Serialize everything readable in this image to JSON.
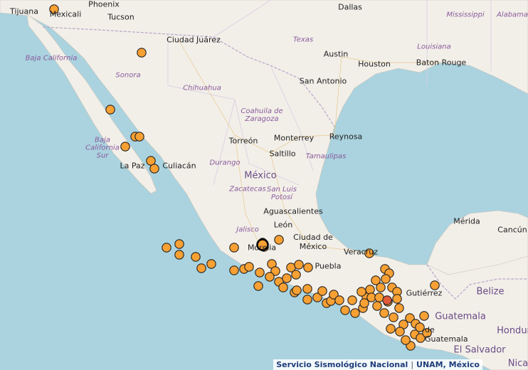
{
  "map": {
    "colors": {
      "land": "#f2efe9",
      "water": "#aad3df",
      "marker_fill": "#f7a033",
      "marker_stroke": "#222222",
      "highlight": "#e05a3a",
      "border": "#b9a6c9"
    },
    "labels": [
      {
        "id": "tijuana",
        "text": "Tijuana",
        "type": "city"
      },
      {
        "id": "mexicali",
        "text": "Mexicali",
        "type": "city"
      },
      {
        "id": "phoenix",
        "text": "Phoenix",
        "type": "city"
      },
      {
        "id": "tucson",
        "text": "Tucson",
        "type": "city"
      },
      {
        "id": "dallas",
        "text": "Dallas",
        "type": "city"
      },
      {
        "id": "ciudad-juarez",
        "text": "Ciudad Juárez",
        "type": "city"
      },
      {
        "id": "texas",
        "text": "Texas",
        "type": "state"
      },
      {
        "id": "austin",
        "text": "Austin",
        "type": "city"
      },
      {
        "id": "houston",
        "text": "Houston",
        "type": "city"
      },
      {
        "id": "san-antonio",
        "text": "San Antonio",
        "type": "city"
      },
      {
        "id": "baton-rouge",
        "text": "Baton Rouge",
        "type": "city"
      },
      {
        "id": "louisiana",
        "text": "Louisiana",
        "type": "state"
      },
      {
        "id": "mississippi",
        "text": "Mississippi",
        "type": "state"
      },
      {
        "id": "alabama",
        "text": "Alabama",
        "type": "state"
      },
      {
        "id": "baja-california",
        "text": "Baja California",
        "type": "state"
      },
      {
        "id": "sonora",
        "text": "Sonora",
        "type": "state"
      },
      {
        "id": "chihuahua",
        "text": "Chihuahua",
        "type": "state"
      },
      {
        "id": "coahuila",
        "text": "Coahuila de Zaragoza",
        "type": "state"
      },
      {
        "id": "monterrey",
        "text": "Monterrey",
        "type": "city"
      },
      {
        "id": "reynosa",
        "text": "Reynosa",
        "type": "city"
      },
      {
        "id": "torreon",
        "text": "Torreón",
        "type": "city"
      },
      {
        "id": "saltillo",
        "text": "Saltillo",
        "type": "city"
      },
      {
        "id": "tamaulipas",
        "text": "Tamaulipas",
        "type": "state"
      },
      {
        "id": "baja-california-sur",
        "text": "Baja California Sur",
        "type": "state"
      },
      {
        "id": "la-paz",
        "text": "La Paz",
        "type": "city"
      },
      {
        "id": "culiacan",
        "text": "Culiacán",
        "type": "city"
      },
      {
        "id": "durango",
        "text": "Durango",
        "type": "state"
      },
      {
        "id": "mexico",
        "text": "México",
        "type": "country"
      },
      {
        "id": "zacatecas",
        "text": "Zacatecas",
        "type": "state"
      },
      {
        "id": "san-luis-potosi",
        "text": "San Luis Potosí",
        "type": "state"
      },
      {
        "id": "aguascalientes",
        "text": "Aguascalientes",
        "type": "city"
      },
      {
        "id": "leon",
        "text": "León",
        "type": "city"
      },
      {
        "id": "jalisco",
        "text": "Jalisco",
        "type": "state"
      },
      {
        "id": "morelia",
        "text": "Morelia",
        "type": "city"
      },
      {
        "id": "ciudad-de-mexico",
        "text": "Ciudad de México",
        "type": "city"
      },
      {
        "id": "veracruz",
        "text": "Veracruz",
        "type": "city"
      },
      {
        "id": "puebla",
        "text": "Puebla",
        "type": "city"
      },
      {
        "id": "merida",
        "text": "Mérida",
        "type": "city"
      },
      {
        "id": "cancun",
        "text": "Cancún",
        "type": "city"
      },
      {
        "id": "gutierrez",
        "text": "Gutiérrez",
        "type": "city"
      },
      {
        "id": "belize",
        "text": "Belize",
        "type": "country"
      },
      {
        "id": "guatemala",
        "text": "Guatemala",
        "type": "country"
      },
      {
        "id": "guatemala-city",
        "text": "de Guatemala",
        "type": "city"
      },
      {
        "id": "honduras",
        "text": "Hondur",
        "type": "country"
      },
      {
        "id": "el-salvador",
        "text": "El Salvador",
        "type": "country"
      },
      {
        "id": "nica",
        "text": "Nica",
        "type": "country"
      }
    ]
  },
  "attribution": {
    "org": "Servicio Sismológico Nacional",
    "sep": "|",
    "univ": "UNAM, México"
  }
}
